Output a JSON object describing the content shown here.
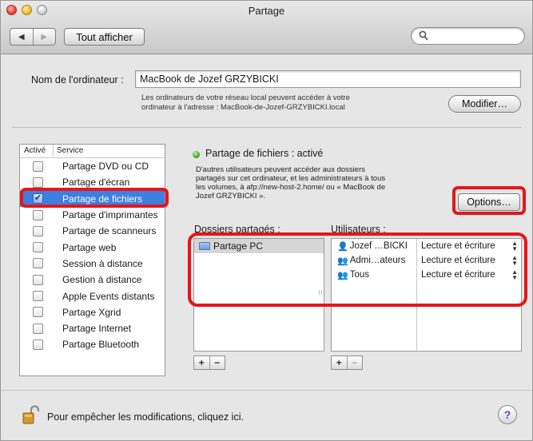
{
  "window": {
    "title": "Partage"
  },
  "toolbar": {
    "back_glyph": "◀",
    "forward_glyph": "▶",
    "show_all_label": "Tout afficher",
    "search_value": ""
  },
  "computer_name": {
    "label": "Nom de l'ordinateur :",
    "value": "MacBook de Jozef GRZYBICKI",
    "description_line1": "Les ordinateurs de votre réseau local peuvent accéder à votre",
    "description_line2": "ordinateur à l'adresse : MacBook-de-Jozef-GRZYBICKI.local",
    "edit_label": "Modifier…"
  },
  "services": {
    "header_active": "Activé",
    "header_service": "Service",
    "items": [
      {
        "label": "Partage DVD ou CD",
        "checked": ""
      },
      {
        "label": "Partage d'écran",
        "checked": ""
      },
      {
        "label": "Partage de fichiers",
        "checked": "✔"
      },
      {
        "label": "Partage d'imprimantes",
        "checked": ""
      },
      {
        "label": "Partage de scanneurs",
        "checked": ""
      },
      {
        "label": "Partage web",
        "checked": ""
      },
      {
        "label": "Session à distance",
        "checked": ""
      },
      {
        "label": "Gestion à distance",
        "checked": ""
      },
      {
        "label": "Apple Events distants",
        "checked": ""
      },
      {
        "label": "Partage Xgrid",
        "checked": ""
      },
      {
        "label": "Partage Internet",
        "checked": ""
      },
      {
        "label": "Partage Bluetooth",
        "checked": ""
      }
    ],
    "selected_index": 2
  },
  "detail": {
    "status": "Partage de fichiers : activé",
    "description_line1": "D'autres utilisateurs peuvent accéder aux dossiers",
    "description_line2": "partagés sur cet ordinateur, et les administrateurs à tous",
    "description_line3": "les volumes, à afp://new-host-2.home/ ou « MacBook de",
    "description_line4": "Jozef GRZYBICKI ».",
    "options_label": "Options…",
    "shared_folders_header": "Dossiers partagés :",
    "users_header": "Utilisateurs :",
    "folders": [
      {
        "name": "Partage PC"
      }
    ],
    "users": [
      {
        "icon": "👤",
        "name": "Jozef …BICKI",
        "permission": "Lecture et écriture"
      },
      {
        "icon": "👥",
        "name": "Admi…ateurs",
        "permission": "Lecture et écriture"
      },
      {
        "icon": "👥",
        "name": "Tous",
        "permission": "Lecture et écriture"
      }
    ],
    "add_label": "+",
    "remove_label": "−"
  },
  "footer": {
    "lock_text": "Pour empêcher les modifications, cliquez ici.",
    "help_label": "?"
  },
  "colors": {
    "selection": "#3d80df",
    "annotation": "#e4161a",
    "status_green": "#3aa21b"
  }
}
